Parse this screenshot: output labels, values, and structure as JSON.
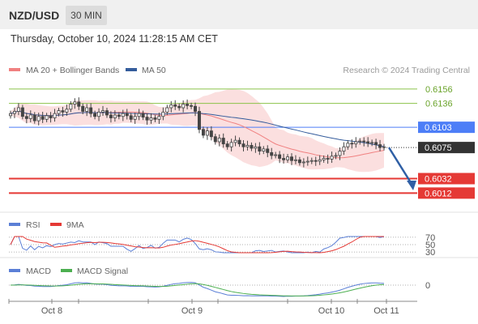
{
  "header": {
    "pair": "NZD/USD",
    "timeframe": "30 MIN"
  },
  "datetime": "Thursday, October 10, 2024 11:28:15 AM CET",
  "legend": {
    "bb": "MA 20 + Bollinger Bands",
    "ma50": "MA 50",
    "source": "Research © 2024 Trading Central"
  },
  "rsi_legend": {
    "rsi": "RSI",
    "ma": "9MA"
  },
  "macd_legend": {
    "macd": "MACD",
    "signal": "MACD Signal"
  },
  "colors": {
    "bb": "#f08080",
    "ma50": "#345c9c",
    "green_level": "#8bc34a",
    "blue_level": "#4d7ef7",
    "red_level": "#e53935",
    "candle_up": "#ffffff",
    "candle_down": "#444444"
  },
  "chart_data": [
    {
      "type": "candlestick",
      "series": [
        {
          "name": "MA 20 + Bollinger Bands"
        },
        {
          "name": "MA 50"
        }
      ],
      "price_range": [
        0.599,
        0.6167
      ],
      "levels": [
        {
          "value": 0.6156,
          "label": "0.6156",
          "kind": "resistance"
        },
        {
          "value": 0.6136,
          "label": "0.6136",
          "kind": "resistance"
        },
        {
          "value": 0.6103,
          "label": "0.6103",
          "kind": "pivot"
        },
        {
          "value": 0.6075,
          "label": "0.6075",
          "kind": "last-price"
        },
        {
          "value": 0.6032,
          "label": "0.6032",
          "kind": "support"
        },
        {
          "value": 0.6012,
          "label": "0.6012",
          "kind": "support"
        }
      ],
      "forecast_arrow": {
        "from": 0.6075,
        "to": 0.6018
      },
      "x_ticks": [
        "Oct 8",
        "Oct 9",
        "Oct 10",
        "Oct 11"
      ],
      "closes": [
        0.6122,
        0.6125,
        0.613,
        0.6118,
        0.6115,
        0.612,
        0.6112,
        0.6118,
        0.6114,
        0.6119,
        0.6116,
        0.6122,
        0.6126,
        0.6124,
        0.6128,
        0.6135,
        0.6138,
        0.6132,
        0.6125,
        0.613,
        0.6122,
        0.6118,
        0.6124,
        0.6126,
        0.612,
        0.6116,
        0.612,
        0.6118,
        0.6122,
        0.6119,
        0.6114,
        0.6118,
        0.6122,
        0.6117,
        0.6113,
        0.6116,
        0.6114,
        0.6118,
        0.6124,
        0.613,
        0.6134,
        0.6132,
        0.613,
        0.6135,
        0.6133,
        0.6132,
        0.6125,
        0.61,
        0.6092,
        0.6098,
        0.609,
        0.6083,
        0.6088,
        0.608,
        0.6076,
        0.6082,
        0.6085,
        0.608,
        0.6076,
        0.6078,
        0.6074,
        0.6076,
        0.607,
        0.6073,
        0.6068,
        0.6064,
        0.6065,
        0.606,
        0.6058,
        0.6062,
        0.6057,
        0.6058,
        0.6054,
        0.6055,
        0.6056,
        0.6057,
        0.6056,
        0.6058,
        0.606,
        0.6059,
        0.6063,
        0.6064,
        0.607,
        0.6076,
        0.6081,
        0.608,
        0.6083,
        0.6084,
        0.6083,
        0.6081,
        0.6082,
        0.6079,
        0.6075,
        0.6076
      ]
    },
    {
      "type": "line",
      "title": "RSI",
      "series": [
        {
          "name": "RSI"
        },
        {
          "name": "9MA"
        }
      ],
      "y_ticks": [
        70,
        50,
        30
      ]
    },
    {
      "type": "line",
      "title": "MACD",
      "series": [
        {
          "name": "MACD"
        },
        {
          "name": "MACD Signal"
        }
      ],
      "y_ticks": [
        0
      ]
    }
  ]
}
